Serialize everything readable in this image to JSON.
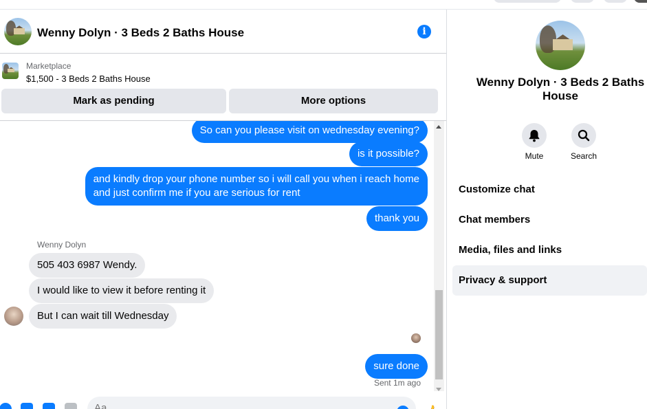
{
  "chat": {
    "title": "Wenny Dolyn · 3 Beds 2 Baths House",
    "listing": {
      "source": "Marketplace",
      "price_title": "$1,500 - 3 Beds 2 Baths House"
    },
    "buttons": {
      "pending": "Mark as pending",
      "options": "More options"
    },
    "messages": [
      {
        "from": "me",
        "text": "So can you please visit on wednesday  evening?"
      },
      {
        "from": "me",
        "text": "is it possible?"
      },
      {
        "from": "me",
        "text": "and kindly drop your phone number so i will call you when i reach home\nand just confirm me if you are serious for rent"
      },
      {
        "from": "me",
        "text": "thank you"
      },
      {
        "from": "them",
        "text": "505 403 6987 Wendy."
      },
      {
        "from": "them",
        "text": "I would like to view it before renting it"
      },
      {
        "from": "them",
        "text": "But I can wait till Wednesday"
      },
      {
        "from": "me",
        "text": "sure done"
      }
    ],
    "sender_name": "Wenny Dolyn",
    "sent_status": "Sent 1m ago",
    "composer_placeholder": "Aa"
  },
  "panel": {
    "title": "Wenny Dolyn · 3 Beds 2 Baths House",
    "mute_label": "Mute",
    "search_label": "Search",
    "menu": [
      "Customize chat",
      "Chat members",
      "Media, files and links",
      "Privacy & support"
    ]
  },
  "colors": {
    "accent": "#0a7cff",
    "bubble_in": "#e9eaed",
    "button_bg": "#e4e6eb"
  },
  "icons": [
    "info-icon",
    "bell-icon",
    "search-icon",
    "plus-icon",
    "photo-icon",
    "sticker-icon",
    "gif-icon",
    "emoji-icon",
    "like-icon"
  ]
}
